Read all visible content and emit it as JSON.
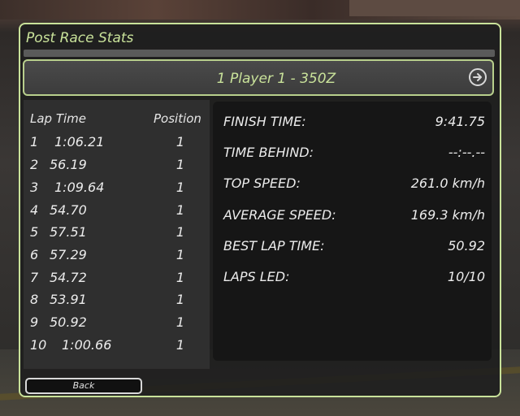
{
  "screen": {
    "title": "Post Race Stats",
    "player_line": "1   Player 1 - 350Z",
    "next_icon": "arrow-right-circle-icon"
  },
  "laps": {
    "header_lap_time": "Lap Time",
    "header_position": "Position",
    "rows": [
      {
        "lap": "1",
        "time": "1:06.21",
        "position": "1"
      },
      {
        "lap": "2",
        "time": "56.19",
        "position": "1"
      },
      {
        "lap": "3",
        "time": "1:09.64",
        "position": "1"
      },
      {
        "lap": "4",
        "time": "54.70",
        "position": "1"
      },
      {
        "lap": "5",
        "time": "57.51",
        "position": "1"
      },
      {
        "lap": "6",
        "time": "57.29",
        "position": "1"
      },
      {
        "lap": "7",
        "time": "54.72",
        "position": "1"
      },
      {
        "lap": "8",
        "time": "53.91",
        "position": "1"
      },
      {
        "lap": "9",
        "time": "50.92",
        "position": "1"
      },
      {
        "lap": "10",
        "time": "1:00.66",
        "position": "1"
      }
    ]
  },
  "stats": [
    {
      "label": "FINISH TIME:",
      "value": "9:41.75"
    },
    {
      "label": "TIME BEHIND:",
      "value": "--:--.--"
    },
    {
      "label": "TOP SPEED:",
      "value": "261.0 km/h"
    },
    {
      "label": "AVERAGE SPEED:",
      "value": "169.3 km/h"
    },
    {
      "label": "BEST LAP TIME:",
      "value": "50.92"
    },
    {
      "label": "LAPS LED:",
      "value": "10/10"
    }
  ],
  "footer": {
    "back_label": "Back"
  },
  "colors": {
    "accent": "#c9e29a",
    "text": "#ececec",
    "panel_dark": "#161616"
  }
}
